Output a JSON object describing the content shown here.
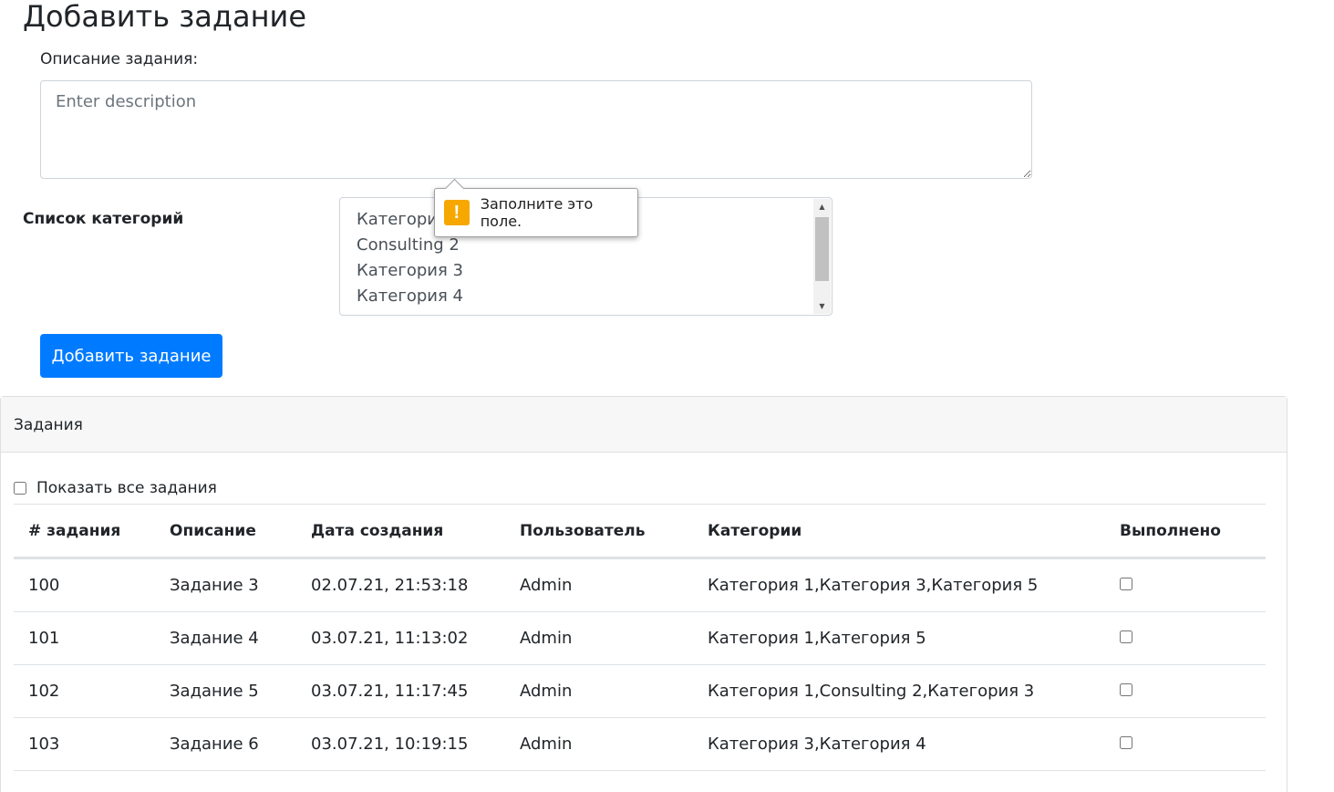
{
  "page": {
    "title": "Добавить задание"
  },
  "form": {
    "description_label": "Описание задания:",
    "description_placeholder": "Enter description",
    "description_value": "",
    "categories_label": "Список категорий",
    "categories": [
      "Категория 1",
      "Consulting 2",
      "Категория 3",
      "Категория 4"
    ],
    "submit_label": "Добавить задание"
  },
  "validation_tooltip": {
    "icon": "warning-icon",
    "icon_glyph": "!",
    "message": "Заполните это поле."
  },
  "tasks": {
    "header": "Задания",
    "show_all_label": "Показать все задания",
    "show_all_checked": false,
    "columns": [
      "# задания",
      "Описание",
      "Дата создания",
      "Пользователь",
      "Категории",
      "Выполнено"
    ],
    "rows": [
      {
        "id": "100",
        "description": "Задание 3",
        "created": "02.07.21, 21:53:18",
        "user": "Admin",
        "categories": "Категория 1,Категория 3,Категория 5",
        "done": false
      },
      {
        "id": "101",
        "description": "Задание 4",
        "created": "03.07.21, 11:13:02",
        "user": "Admin",
        "categories": "Категория 1,Категория 5",
        "done": false
      },
      {
        "id": "102",
        "description": "Задание 5",
        "created": "03.07.21, 11:17:45",
        "user": "Admin",
        "categories": "Категория 1,Consulting 2,Категория 3",
        "done": false
      },
      {
        "id": "103",
        "description": "Задание 6",
        "created": "03.07.21, 10:19:15",
        "user": "Admin",
        "categories": "Категория 3,Категория 4",
        "done": false
      }
    ]
  },
  "colors": {
    "primary": "#007bff",
    "warning": "#f6a800",
    "border": "#dee2e6",
    "card_header_bg": "#f7f7f7"
  }
}
